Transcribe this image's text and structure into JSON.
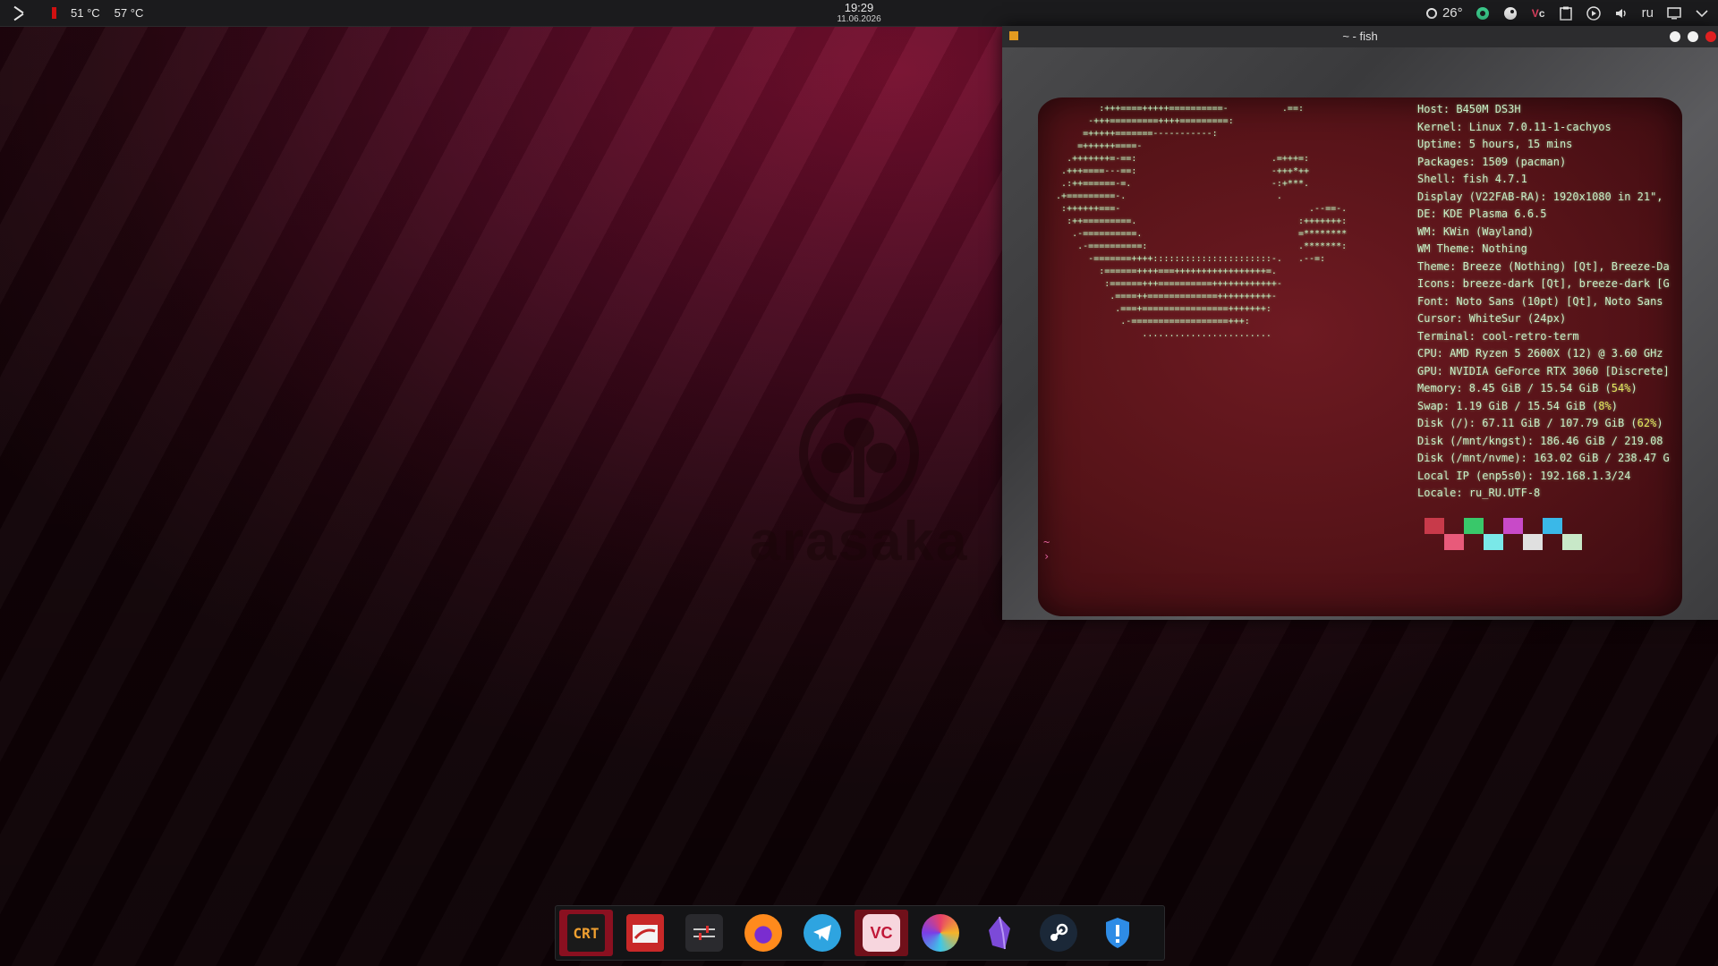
{
  "panel": {
    "cpu_temp": "51 °C",
    "gpu_temp": "57 °C",
    "time": "19:29",
    "date": "11.06.2026",
    "weather_temp": "26°",
    "language": "ru"
  },
  "wallpaper": {
    "logo_text": "arasaka"
  },
  "terminal_window": {
    "title": "~ - fish",
    "ascii_art": "          :+++====+++++==========-          .==:\n        -+++=========++++=========:\n       =+++++=======-----------:\n      =++++++====-\n    .+++++++=-==:                         .=+++=:\n   .+++====---==:                         -+++*++\n   .:++======-=.                          -:+***.\n  .+=========-.                            .\n   :++++++===-                                   .--==-.\n    :++=========.                              :+++++++:\n     .-==========.                             =********\n      .-==========:                            .*******:\n        -=======++++::::::::::::::::::::::-.   .--=:\n          :======++++===+++++++++++++++++=.\n           :======+++==========++++++++++++-\n            .====++=============++++++++++-\n             .===+================+++++++:\n              .-==================+++:\n                  ........................",
    "info": [
      "Host: B450M DS3H",
      "Kernel: Linux 7.0.11-1-cachyos",
      "Uptime: 5 hours, 15 mins",
      "Packages: 1509 (pacman)",
      "Shell: fish 4.7.1",
      "Display (V22FAB-RA): 1920x1080 in 21\",",
      "DE: KDE Plasma 6.6.5",
      "WM: KWin (Wayland)",
      "WM Theme: Nothing",
      "Theme: Breeze (Nothing) [Qt], Breeze-Da",
      "Icons: breeze-dark [Qt], breeze-dark [G",
      "Font: Noto Sans (10pt) [Qt], Noto Sans",
      "Cursor: WhiteSur (24px)",
      "Terminal: cool-retro-term",
      "CPU: AMD Ryzen 5 2600X (12) @ 3.60 GHz",
      "GPU: NVIDIA GeForce RTX 3060 [Discrete]"
    ],
    "memory_label": "Memory: 8.45 GiB / 15.54 GiB (",
    "memory_pct": "54%",
    "swap_label": "Swap: 1.19 GiB / 15.54 GiB (",
    "swap_pct": "8%",
    "disk_root_label": "Disk (/): 67.11 GiB / 107.79 GiB (",
    "disk_root_pct": "62%",
    "info_tail": [
      "Disk (/mnt/kngst): 186.46 GiB / 219.08",
      "Disk (/mnt/nvme): 163.02 GiB / 238.47 G",
      "Local IP (enp5s0): 192.168.1.3/24",
      "Locale: ru_RU.UTF-8"
    ],
    "palette_colors": [
      "#c83a4a",
      "#e85a7a",
      "#39c86a",
      "#7ae8e8",
      "#c84ac8",
      "#e0e0e0",
      "#3ab8e8",
      "#c8e8c8"
    ],
    "prompt": "~",
    "prompt_char": "›"
  },
  "dock": {
    "items": [
      {
        "name": "cool-retro-term",
        "label": "CRT"
      },
      {
        "name": "file-manager",
        "label": ""
      },
      {
        "name": "mixer",
        "label": ""
      },
      {
        "name": "firefox",
        "label": ""
      },
      {
        "name": "telegram",
        "label": ""
      },
      {
        "name": "vencord",
        "label": "VC"
      },
      {
        "name": "ksnip",
        "label": ""
      },
      {
        "name": "obsidian",
        "label": ""
      },
      {
        "name": "steam",
        "label": ""
      },
      {
        "name": "security",
        "label": ""
      }
    ]
  }
}
